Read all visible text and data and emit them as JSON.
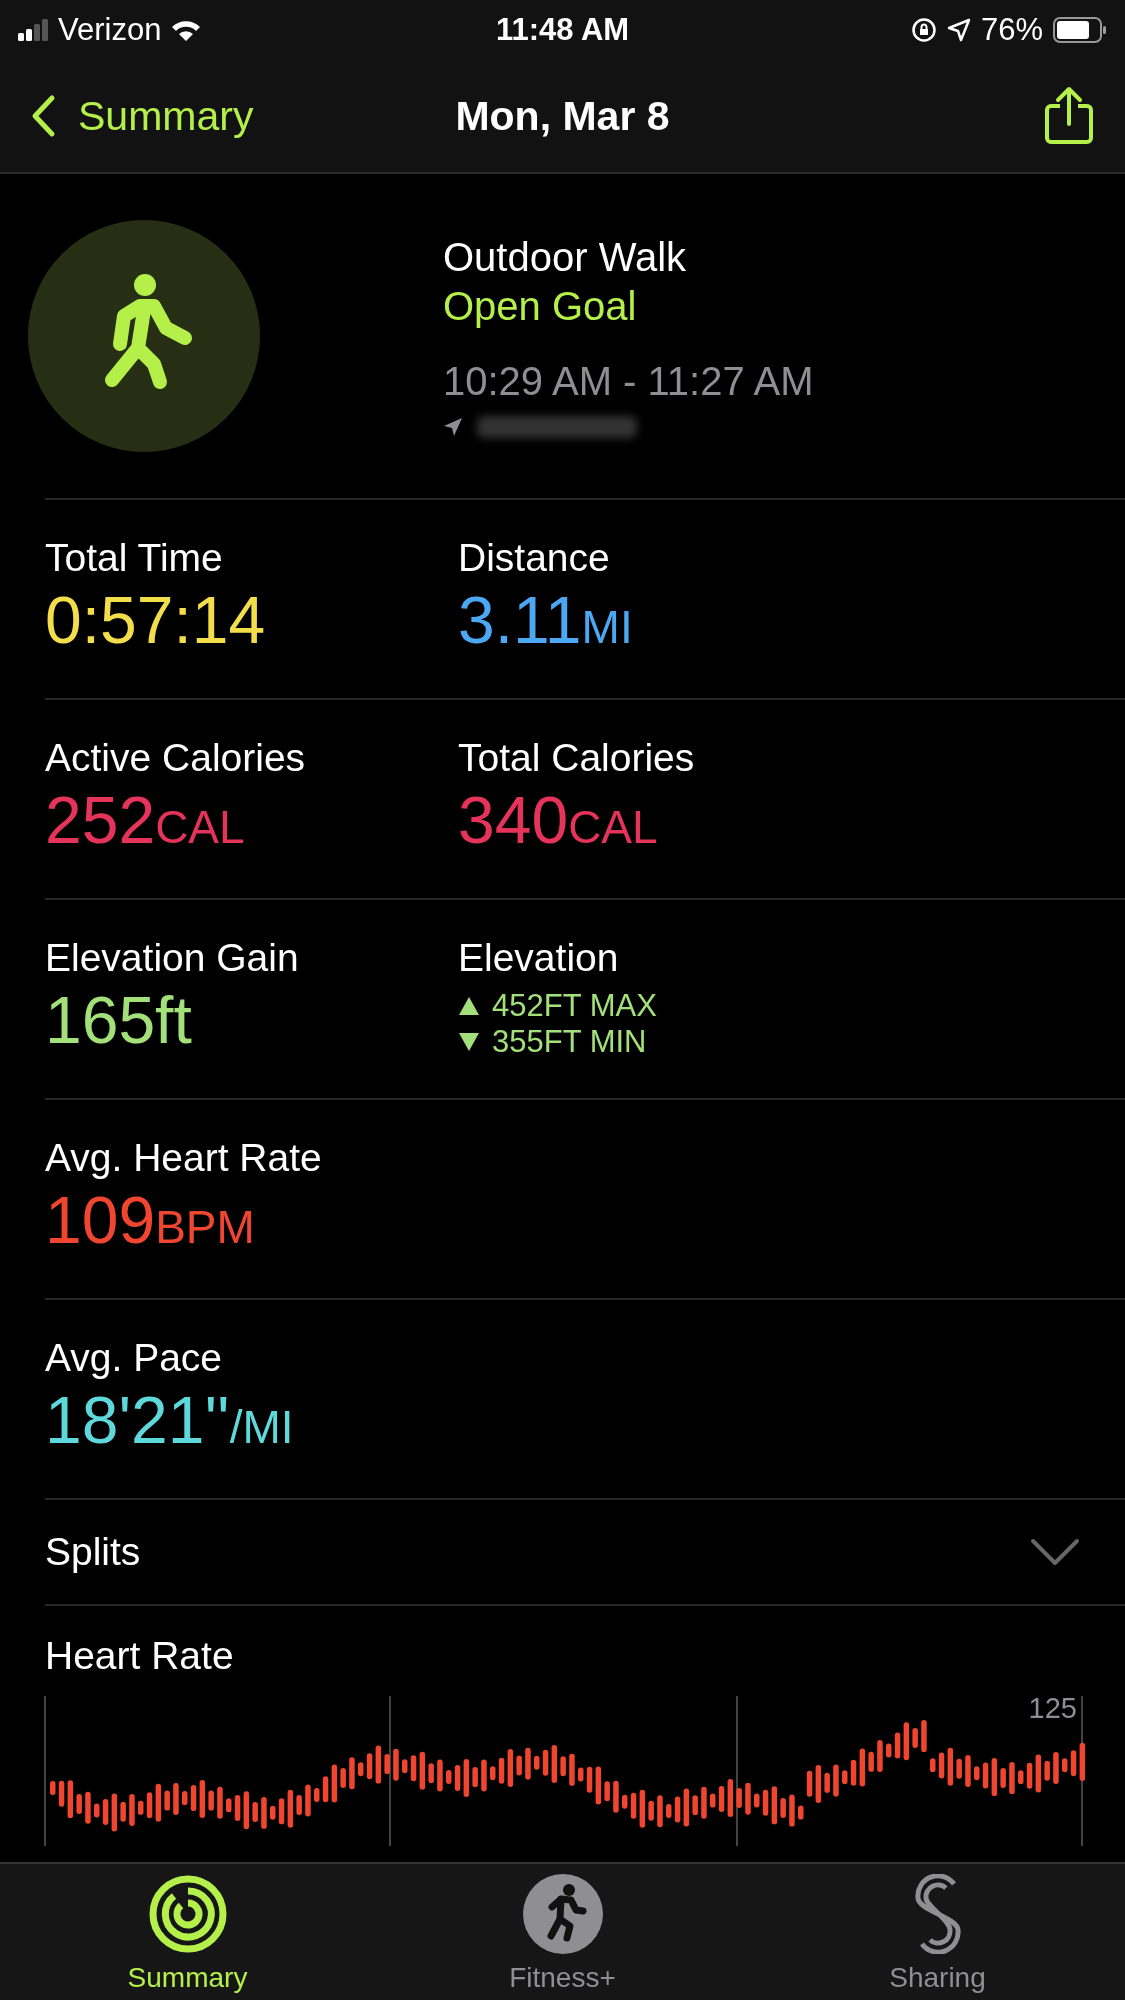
{
  "status_bar": {
    "carrier": "Verizon",
    "time": "11:48 AM",
    "battery": "76%"
  },
  "nav": {
    "back": "Summary",
    "title": "Mon, Mar 8"
  },
  "workout": {
    "name": "Outdoor Walk",
    "goal": "Open Goal",
    "time_range": "10:29 AM - 11:27 AM"
  },
  "metric_rows": [
    {
      "cells": [
        {
          "kind": "value",
          "label": "Total Time",
          "value": "0:57:14",
          "color": "#f2dd4b"
        },
        {
          "kind": "value",
          "label": "Distance",
          "value": "3.11",
          "unit": "MI",
          "color": "#4ca8f2"
        }
      ]
    },
    {
      "cells": [
        {
          "kind": "value",
          "label": "Active Calories",
          "value": "252",
          "unit": "CAL",
          "color": "#e6335a"
        },
        {
          "kind": "value",
          "label": "Total Calories",
          "value": "340",
          "unit": "CAL",
          "color": "#e6335a"
        }
      ]
    },
    {
      "cells": [
        {
          "kind": "value",
          "label": "Elevation Gain",
          "value": "165ft",
          "color": "#a3e07a"
        },
        {
          "kind": "range",
          "label": "Elevation",
          "color": "#a3e07a",
          "lines": [
            {
              "kind": "up",
              "text": "452FT MAX"
            },
            {
              "kind": "down",
              "text": "355FT MIN"
            }
          ]
        }
      ]
    },
    {
      "cells": [
        {
          "kind": "value",
          "label": "Avg. Heart Rate",
          "value": "109",
          "unit": "BPM",
          "color": "#f0452f"
        }
      ]
    },
    {
      "cells": [
        {
          "kind": "value",
          "label": "Avg. Pace",
          "value": "18'21''",
          "unit": "/MI",
          "color": "#5fd8dc"
        }
      ]
    }
  ],
  "splits": {
    "label": "Splits",
    "expanded": false
  },
  "heart_rate": {
    "title": "Heart Rate",
    "max_label": "125"
  },
  "tabs": [
    {
      "kind": "summary",
      "label": "Summary",
      "selected": true
    },
    {
      "kind": "fitness",
      "label": "Fitness+",
      "selected": false
    },
    {
      "kind": "sharing",
      "label": "Sharing",
      "selected": false
    }
  ]
}
